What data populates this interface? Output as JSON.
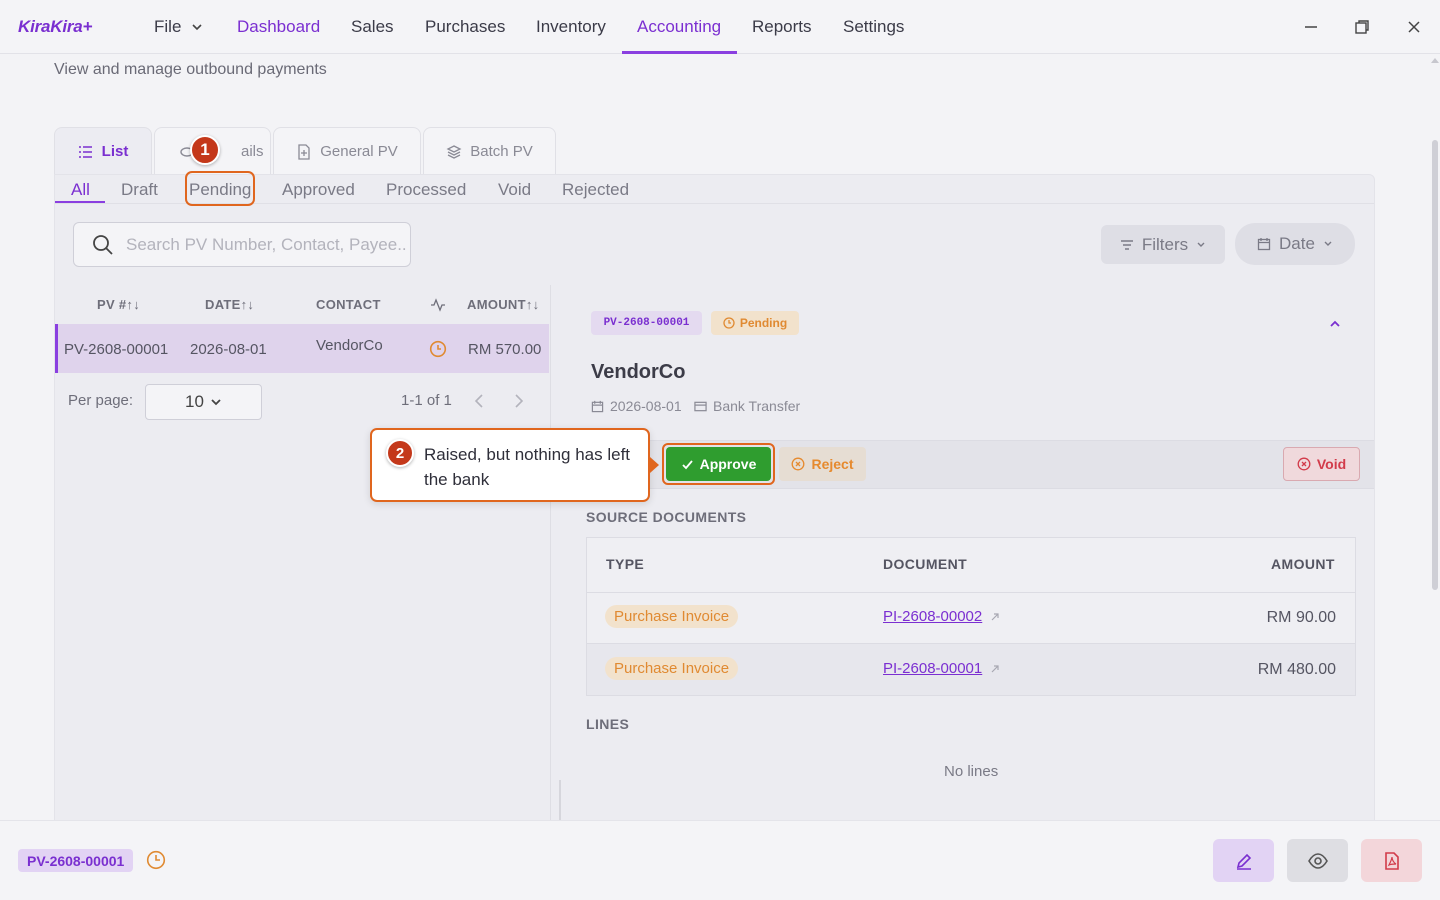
{
  "app": {
    "logo": "KiraKira+"
  },
  "menu": {
    "file": "File",
    "items": [
      "Dashboard",
      "Sales",
      "Purchases",
      "Inventory",
      "Accounting",
      "Reports",
      "Settings"
    ],
    "active": "Accounting"
  },
  "page": {
    "subtitle": "View and manage outbound payments"
  },
  "view_tabs": [
    {
      "label": "List",
      "icon": "list-icon"
    },
    {
      "label": "Details",
      "icon": "eye-icon"
    },
    {
      "label": "General PV",
      "icon": "document-plus-icon"
    },
    {
      "label": "Batch PV",
      "icon": "layers-icon"
    }
  ],
  "details_tab_visible": "ails",
  "status_tabs": [
    "All",
    "Draft",
    "Pending",
    "Approved",
    "Processed",
    "Void",
    "Rejected"
  ],
  "search": {
    "placeholder": "Search PV Number, Contact, Payee..."
  },
  "filters": {
    "filters_label": "Filters",
    "date_label": "Date"
  },
  "table": {
    "headers": {
      "pv": "PV #",
      "date": "DATE",
      "contact": "CONTACT",
      "amount": "AMOUNT"
    },
    "rows": [
      {
        "pv": "PV-2608-00001",
        "date": "2026-08-01",
        "contact": "VendorCo",
        "status_icon": "clock-icon",
        "amount": "RM 570.00"
      }
    ]
  },
  "pagination": {
    "per_page_label": "Per page:",
    "per_page": "10",
    "range": "1-1 of 1"
  },
  "detail": {
    "pv_number": "PV-2608-00001",
    "status": "Pending",
    "vendor": "VendorCo",
    "date": "2026-08-01",
    "method": "Bank Transfer",
    "approve_label": "Approve",
    "reject_label": "Reject",
    "void_label": "Void",
    "source_docs_heading": "SOURCE DOCUMENTS",
    "doc_headers": {
      "type": "TYPE",
      "document": "DOCUMENT",
      "amount": "AMOUNT"
    },
    "docs": [
      {
        "type": "Purchase Invoice",
        "document": "PI-2608-00002",
        "amount": "RM 90.00"
      },
      {
        "type": "Purchase Invoice",
        "document": "PI-2608-00001",
        "amount": "RM 480.00"
      }
    ],
    "lines_heading": "LINES",
    "no_lines": "No lines"
  },
  "annotations": {
    "step1": "1",
    "step2": "2",
    "callout": "Raised, but nothing has left the bank"
  },
  "bottom": {
    "pv_number": "PV-2608-00001"
  },
  "colors": {
    "accent": "#7b2fd1",
    "approve": "#2f9d2f",
    "pending": "#e08a32",
    "void": "#d23b4a",
    "annotation": "#e0661e"
  }
}
